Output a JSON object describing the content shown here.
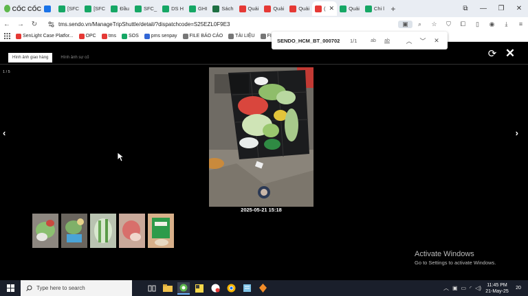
{
  "browser": {
    "logo_text": "CỐC CỐC",
    "tabs": [
      {
        "label": "",
        "color": "#1a73e8"
      },
      {
        "label": "[SFC",
        "color": "#16a765"
      },
      {
        "label": "[SFC",
        "color": "#16a765"
      },
      {
        "label": "Đầu",
        "color": "#16a765"
      },
      {
        "label": "SFC_",
        "color": "#16a765"
      },
      {
        "label": "DS H",
        "color": "#16a765"
      },
      {
        "label": "GHI",
        "color": "#16a765"
      },
      {
        "label": "Sách",
        "color": "#1d6f42"
      },
      {
        "label": "Quải",
        "color": "#e53935"
      },
      {
        "label": "Quải",
        "color": "#e53935"
      },
      {
        "label": "Quải",
        "color": "#e53935"
      },
      {
        "label": "(",
        "color": "#e53935",
        "active": true
      },
      {
        "label": "Quải",
        "color": "#16a765"
      },
      {
        "label": "Chi l",
        "color": "#16a765"
      }
    ],
    "url": "tms.sendo.vn/ManageTripShuttle/detail/?dispatchcode=S25EZL0F9E3",
    "bookmarks": [
      {
        "label": "SenLight Case Platfor...",
        "color": "#e53935"
      },
      {
        "label": "OPC",
        "color": "#e53935"
      },
      {
        "label": "tms",
        "color": "#e53935"
      },
      {
        "label": "SOS",
        "color": "#16a765"
      },
      {
        "label": "pms senpay",
        "color": "#3367d6"
      },
      {
        "label": "FILE BÁO CÁO",
        "color": "#777777"
      },
      {
        "label": "TÀI LIỆU",
        "color": "#777777"
      },
      {
        "label": "FILE C",
        "color": "#777777"
      }
    ]
  },
  "findbar": {
    "query": "SENDO_HCM_BT_000702",
    "count": "1/1",
    "opt_case": "ab",
    "opt_word": "ab"
  },
  "viewer": {
    "tab_delivery": "Hình ảnh giao hàng",
    "tab_incident": "Hình ảnh sự cố",
    "counter": "1 / 5",
    "caption": "2025-05-21 15:18",
    "thumb_count": 5
  },
  "watermark": {
    "title": "Activate Windows",
    "subtitle": "Go to Settings to activate Windows."
  },
  "taskbar": {
    "search_placeholder": "Type here to search",
    "time": "11:45 PM",
    "date": "21-May-25",
    "notif_count": "20"
  }
}
